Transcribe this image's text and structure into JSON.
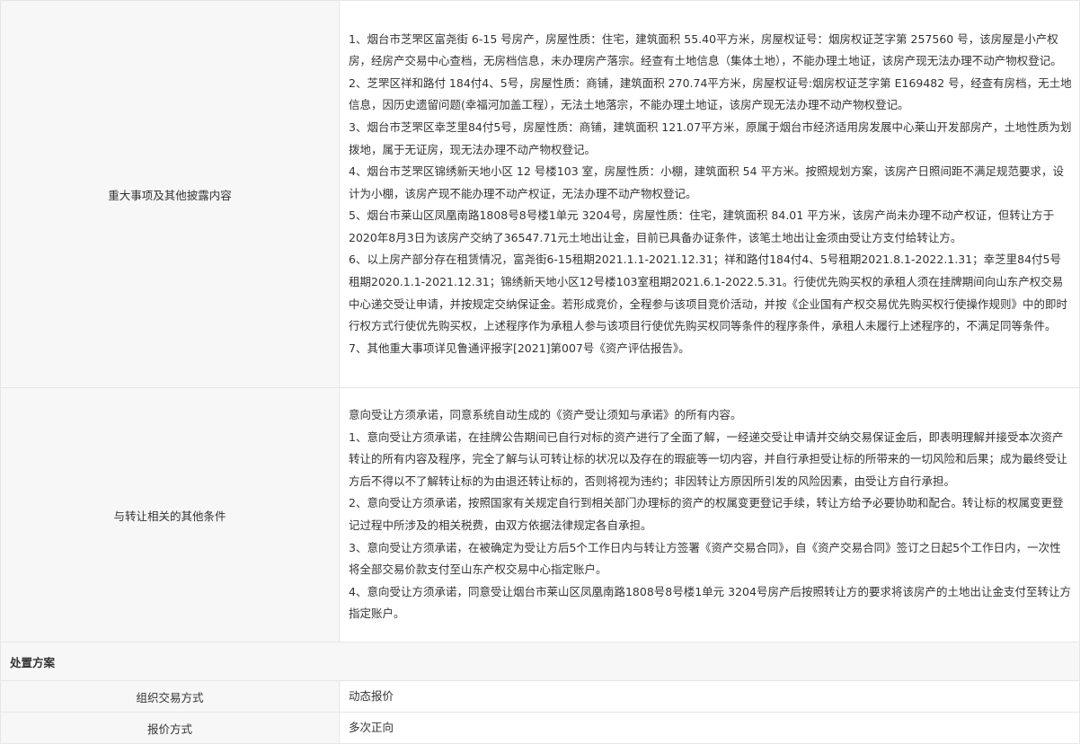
{
  "rows": [
    {
      "label": "重大事项及其他披露内容",
      "paragraphs": [
        "1、烟台市芝罘区富尧街 6-15 号房产，房屋性质：住宅，建筑面积 55.40平方米，房屋权证号：烟房权证芝字第 257560 号，该房屋是小产权房，经房产交易中心查档，无房档信息，未办理房产落宗。经查有土地信息（集体土地），不能办理土地证，该房产现无法办理不动产物权登记。",
        "2、芝罘区祥和路付 184付4、5号，房屋性质：商铺，建筑面积 270.74平方米，房屋权证号:烟房权证芝字第 E169482 号，经查有房档，无土地信息，因历史遗留问题(幸福河加盖工程），无法土地落宗，不能办理土地证，该房产现无法办理不动产物权登记。",
        "3、烟台市芝罘区幸芝里84付5号，房屋性质：商铺，建筑面积 121.07平方米，原属于烟台市经济适用房发展中心莱山开发部房产，土地性质为划拨地，属于无证房，现无法办理不动产物权登记。",
        "4、烟台市芝罘区锦绣新天地小区 12 号楼103 室，房屋性质：小棚，建筑面积 54 平方米。按照规划方案，该房产日照间距不满足规范要求，设计为小棚，该房产现不能办理不动产权证，无法办理不动产物权登记。",
        "5、烟台市莱山区凤凰南路1808号8号楼1单元 3204号，房屋性质：住宅，建筑面积 84.01 平方米，该房产尚未办理不动产权证，但转让方于2020年8月3日为该房产交纳了36547.71元土地出让金，目前已具备办证条件，该笔土地出让金须由受让方支付给转让方。",
        "6、以上房产部分存在租赁情况，富尧街6-15租期2021.1.1-2021.12.31；祥和路付184付4、5号租期2021.8.1-2022.1.31；幸芝里84付5号租期2020.1.1-2021.12.31；锦绣新天地小区12号楼103室租期2021.6.1-2022.5.31。行使优先购买权的承租人须在挂牌期间向山东产权交易中心递交受让申请，并按规定交纳保证金。若形成竞价，全程参与该项目竞价活动，并按《企业国有产权交易优先购买权行使操作规则》中的即时行权方式行使优先购买权，上述程序作为承租人参与该项目行使优先购买权同等条件的程序条件，承租人未履行上述程序的，不满足同等条件。",
        "7、其他重大事项详见鲁通评报字[2021]第007号《资产评估报告》。"
      ]
    },
    {
      "label": "与转让相关的其他条件",
      "paragraphs": [
        "意向受让方须承诺，同意系统自动生成的《资产受让须知与承诺》的所有内容。",
        "1、意向受让方须承诺，在挂牌公告期间已自行对标的资产进行了全面了解，一经递交受让申请并交纳交易保证金后，即表明理解并接受本次资产转让的所有内容及程序，完全了解与认可转让标的状况以及存在的瑕疵等一切内容，并自行承担受让标的所带来的一切风险和后果；成为最终受让方后不得以不了解转让标的为由退还转让标的，否则将视为违约；非因转让方原因所引发的风险因素，由受让方自行承担。",
        "2、意向受让方须承诺，按照国家有关规定自行到相关部门办理标的资产的权属变更登记手续，转让方给予必要协助和配合。转让标的权属变更登记过程中所涉及的相关税费，由双方依据法律规定各自承担。",
        "3、意向受让方须承诺，在被确定为受让方后5个工作日内与转让方签署《资产交易合同》，自《资产交易合同》签订之日起5个工作日内，一次性将全部交易价款支付至山东产权交易中心指定账户。",
        "4、意向受让方须承诺，同意受让烟台市莱山区凤凰南路1808号8号楼1单元 3204号房产后按照转让方的要求将该房产的土地出让金支付至转让方指定账户。"
      ]
    }
  ],
  "section": {
    "title": "处置方案"
  },
  "plan": [
    {
      "label": "组织交易方式",
      "value": "动态报价"
    },
    {
      "label": "报价方式",
      "value": "多次正向"
    }
  ]
}
